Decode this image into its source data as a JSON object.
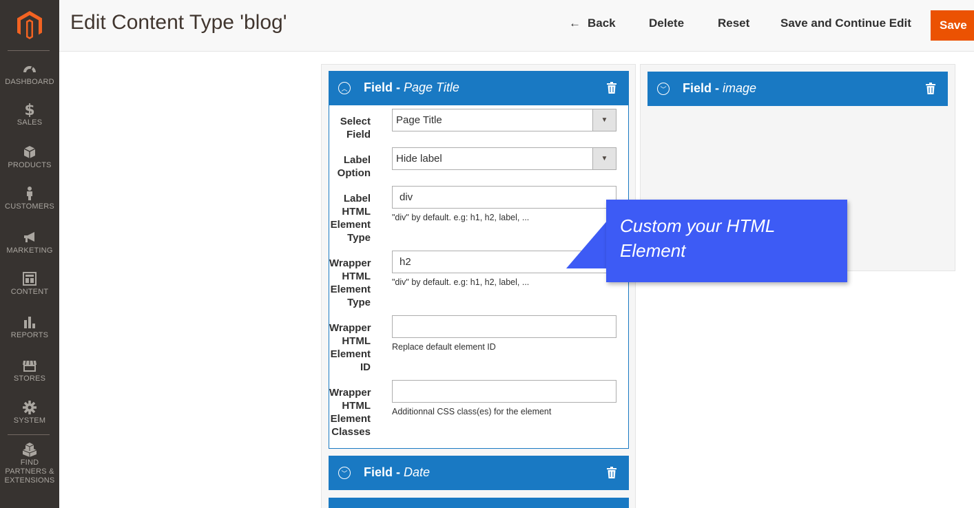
{
  "sidebar": {
    "items": [
      {
        "label": "DASHBOARD",
        "icon": "dashboard-icon"
      },
      {
        "label": "SALES",
        "icon": "dollar-icon"
      },
      {
        "label": "PRODUCTS",
        "icon": "cube-icon"
      },
      {
        "label": "CUSTOMERS",
        "icon": "person-icon"
      },
      {
        "label": "MARKETING",
        "icon": "megaphone-icon"
      },
      {
        "label": "CONTENT",
        "icon": "layout-icon"
      },
      {
        "label": "REPORTS",
        "icon": "bar-chart-icon"
      },
      {
        "label": "STORES",
        "icon": "storefront-icon"
      },
      {
        "label": "SYSTEM",
        "icon": "gear-icon"
      },
      {
        "label": "FIND PARTNERS & EXTENSIONS",
        "icon": "boxes-icon"
      }
    ]
  },
  "header": {
    "title": "Edit Content Type 'blog'",
    "back_label": "Back",
    "delete_label": "Delete",
    "reset_label": "Reset",
    "save_continue_label": "Save and Continue Edit",
    "save_label": "Save"
  },
  "fields": {
    "page_title": {
      "prefix": "Field - ",
      "name": "Page Title"
    },
    "image": {
      "prefix": "Field - ",
      "name": "image"
    },
    "date": {
      "prefix": "Field - ",
      "name": "Date"
    }
  },
  "form": {
    "select_field": {
      "label": "Select Field",
      "value": "Page Title"
    },
    "label_option": {
      "label": "Label Option",
      "value": "Hide label"
    },
    "label_html_type": {
      "label": "Label HTML Element Type",
      "value": "div",
      "note": "\"div\" by default. e.g: h1, h2, label, ..."
    },
    "wrapper_html_type": {
      "label": "Wrapper HTML Element Type",
      "value": "h2",
      "note": "\"div\" by default. e.g: h1, h2, label, ..."
    },
    "wrapper_html_id": {
      "label": "Wrapper HTML Element ID",
      "value": "",
      "note": "Replace default element ID"
    },
    "wrapper_html_classes": {
      "label": "Wrapper HTML Element Classes",
      "value": "",
      "note": "Additionnal CSS class(es) for the element"
    }
  },
  "callout": {
    "text": "Custom your HTML Element"
  },
  "colors": {
    "sidebar_bg": "#373330",
    "accent_blue": "#1979c3",
    "save_orange": "#eb5202",
    "callout_blue": "#3d5bf5"
  }
}
